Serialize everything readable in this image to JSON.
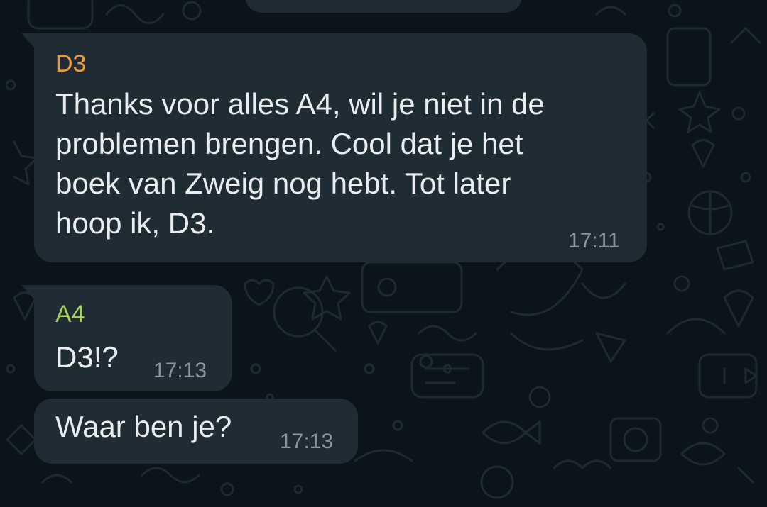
{
  "theme": {
    "background": "#0b141a",
    "bubble": "#202c33",
    "text": "#e9edef",
    "meta": "#8696a0",
    "sender_colors": {
      "D3": "#f09a37",
      "A4": "#a5d160"
    }
  },
  "messages": [
    {
      "sender": "D3",
      "lines": [
        "Thanks voor alles A4, wil je niet in de",
        "problemen brengen. Cool dat je het",
        "boek van Zweig nog hebt. Tot later",
        "hoop ik, D3."
      ],
      "time": "17:11"
    },
    {
      "sender": "A4",
      "text": "D3!?",
      "time": "17:13"
    },
    {
      "text": "Waar ben je?",
      "time": "17:13"
    }
  ]
}
